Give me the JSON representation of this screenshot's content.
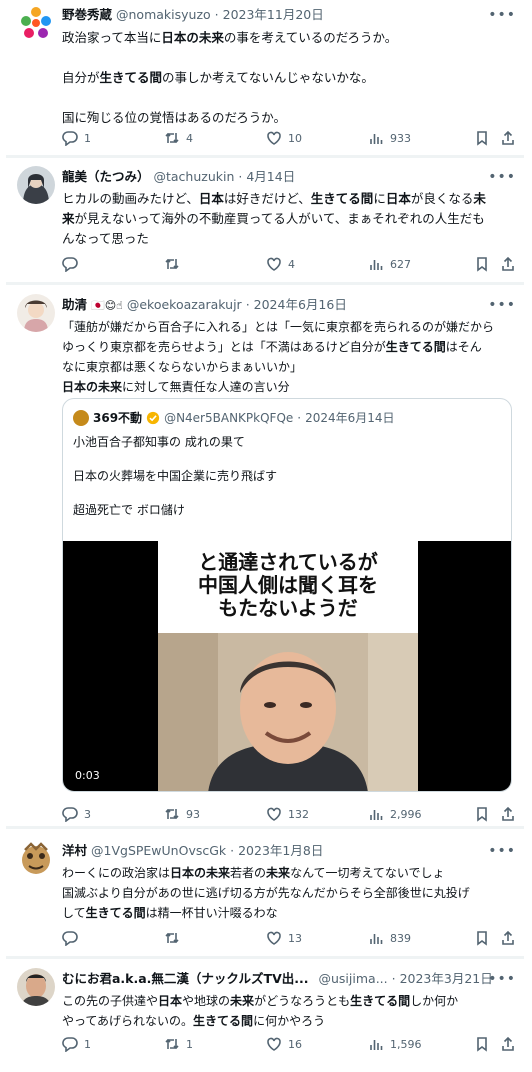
{
  "tweets": [
    {
      "name": "野巻秀蔵",
      "handle": "@nomakisyuzo",
      "dot": "·",
      "date": "2023年11月20日",
      "lines": [
        [
          "政治家って本当に",
          "日本の未来",
          "の事を考えているのだろうか。"
        ],
        [
          "自分が",
          "生きてる間",
          "の事しか考えてないんじゃないかな。"
        ],
        [
          "国に殉じる位の覚悟はあるのだろうか。"
        ]
      ],
      "stats": {
        "reply": "1",
        "retweet": "4",
        "like": "10",
        "views": "933"
      }
    },
    {
      "name": "龍美（たつみ）",
      "handle": "@tachuzukin",
      "dot": "·",
      "date": "4月14日",
      "line1": [
        "ヒカルの動画みたけど、",
        "日本",
        "は好きだけど、",
        "生きてる間",
        "に",
        "日本",
        "が良くなる",
        "未"
      ],
      "line2": [
        "来",
        "が見えないって海外の不動産買ってる人がいて、まぁそれぞれの人生だも"
      ],
      "line3": "んなって思った",
      "stats": {
        "reply": "",
        "retweet": "",
        "like": "4",
        "views": "627"
      }
    },
    {
      "name": "助清",
      "emoji": "🇯🇵😊☝",
      "handle": "@ekoekoazarakujr",
      "dot": "·",
      "date": "2024年6月16日",
      "l1": "「蓮舫が嫌だから百合子に入れる」とは「一気に東京都を売られるのが嫌だから",
      "l2": "ゆっくり東京都を売らせよう」とは「不満はあるけど自分が",
      "l2b": "生きてる間",
      "l2c": "はそん",
      "l3": "なに東京都は悪くならないからまぁいいか」",
      "l4b": "日本の未来",
      "l4c": "に対して無責任な人達の言い分",
      "quote": {
        "name": "369不動",
        "handle": "@N4er5BANKPkQFQe",
        "dot": "·",
        "date": "2024年6月14日",
        "lines": [
          "小池百合子都知事の 成れの果て",
          "日本の火葬場を中国企業に売り飛ばす",
          "超過死亡で ボロ儲け"
        ],
        "video_caption": [
          "と通達されているが",
          "中国人側は聞く耳を",
          "もたないようだ"
        ],
        "video_time": "0:03"
      },
      "stats": {
        "reply": "3",
        "retweet": "93",
        "like": "132",
        "views": "2,996"
      }
    },
    {
      "name": "洋村",
      "handle": "@1VgSPEwUnOvscGk",
      "dot": "·",
      "date": "2023年1月8日",
      "line1": [
        "わーくにの政治家は",
        "日本の未来",
        "若者の",
        "未来",
        "なんて一切考えてないでしょ"
      ],
      "line2": "国滅ぶより自分があの世に逃げ切る方が先なんだからそら全部後世に丸投げ",
      "line3": [
        "して",
        "生きてる間",
        "は精一杯甘い汁啜るわな"
      ],
      "stats": {
        "reply": "",
        "retweet": "",
        "like": "13",
        "views": "839"
      }
    },
    {
      "name": "むにお君a.k.a.無二漢（ナックルズTV出...",
      "handle": "@usijima...",
      "dot": "·",
      "date": "2023年3月21日",
      "line1": [
        "この先の子供達や",
        "日本",
        "や地球の",
        "未来",
        "がどうなろうとも",
        "生きてる間",
        "しか何か"
      ],
      "line2": [
        "やってあげられないの。",
        "生きてる間",
        "に何かやろう"
      ],
      "stats": {
        "reply": "1",
        "retweet": "1",
        "like": "16",
        "views": "1,596"
      }
    }
  ],
  "more_icon": "more-horizontal-icon",
  "colors": {
    "text": "#0f1419",
    "muted": "#536471",
    "border": "#cfd9de",
    "separator": "#eff3f4",
    "verified": "#f7b500"
  }
}
